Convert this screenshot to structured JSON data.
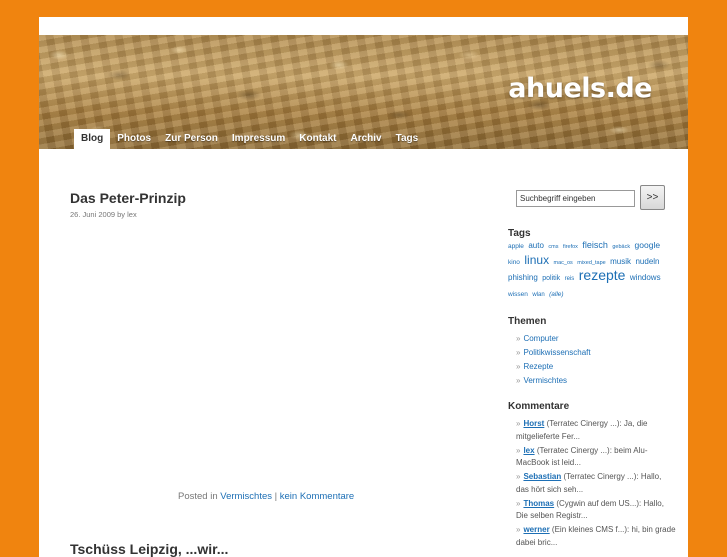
{
  "site": {
    "title": "ahuels.de"
  },
  "nav": {
    "items": [
      {
        "label": "Blog",
        "active": true
      },
      {
        "label": "Photos"
      },
      {
        "label": "Zur Person"
      },
      {
        "label": "Impressum"
      },
      {
        "label": "Kontakt"
      },
      {
        "label": "Archiv"
      },
      {
        "label": "Tags"
      }
    ]
  },
  "post": {
    "title": "Das Peter-Prinzip",
    "meta": "26. Juni 2009 by lex",
    "footer_prefix": "Posted in",
    "category": "Vermischtes",
    "separator": "|",
    "comments_link": "kein Kommentare"
  },
  "next_post": {
    "title": "Tschüss Leipzig, ...wir..."
  },
  "search": {
    "value": "Suchbegriff eingeben",
    "button_label": ">>"
  },
  "tags": {
    "heading": "Tags",
    "items": [
      {
        "label": "apple",
        "size": 6.5
      },
      {
        "label": "auto",
        "size": 8
      },
      {
        "label": "cms",
        "size": 5.5
      },
      {
        "label": "firefox",
        "size": 5.5
      },
      {
        "label": "fleisch",
        "size": 9
      },
      {
        "label": "gebäck",
        "size": 5.5
      },
      {
        "label": "google",
        "size": 8.5
      },
      {
        "label": "kino",
        "size": 6.5
      },
      {
        "label": "linux",
        "size": 12
      },
      {
        "label": "mac_os",
        "size": 5.5
      },
      {
        "label": "mixed_tape",
        "size": 5.5
      },
      {
        "label": "musik",
        "size": 8
      },
      {
        "label": "nudeln",
        "size": 8
      },
      {
        "label": "phishing",
        "size": 8
      },
      {
        "label": "politik",
        "size": 7
      },
      {
        "label": "reis",
        "size": 6
      },
      {
        "label": "rezepte",
        "size": 14
      },
      {
        "label": "windows",
        "size": 8
      },
      {
        "label": "wissen",
        "size": 6.5
      },
      {
        "label": "wlan",
        "size": 6
      }
    ],
    "all_label": "(alle)"
  },
  "themen": {
    "heading": "Themen",
    "items": [
      "Computer",
      "Politikwissenschaft",
      "Rezepte",
      "Vermischtes"
    ]
  },
  "comments": {
    "heading": "Kommentare",
    "items": [
      {
        "author": "Horst",
        "text": "(Terratec Cinergy ...): Ja, die mitgelieferte Fer..."
      },
      {
        "author": "lex",
        "text": "(Terratec Cinergy ...): beim Alu-MacBook ist leid..."
      },
      {
        "author": "Sebastian",
        "text": "(Terratec Cinergy ...): Hallo, das hört sich seh..."
      },
      {
        "author": "Thomas",
        "text": "(Cygwin auf dem US...): Hallo, Die selben Registr..."
      },
      {
        "author": "werner",
        "text": "(Ein kleines CMS f...): hi, bin grade dabei bric..."
      }
    ]
  }
}
